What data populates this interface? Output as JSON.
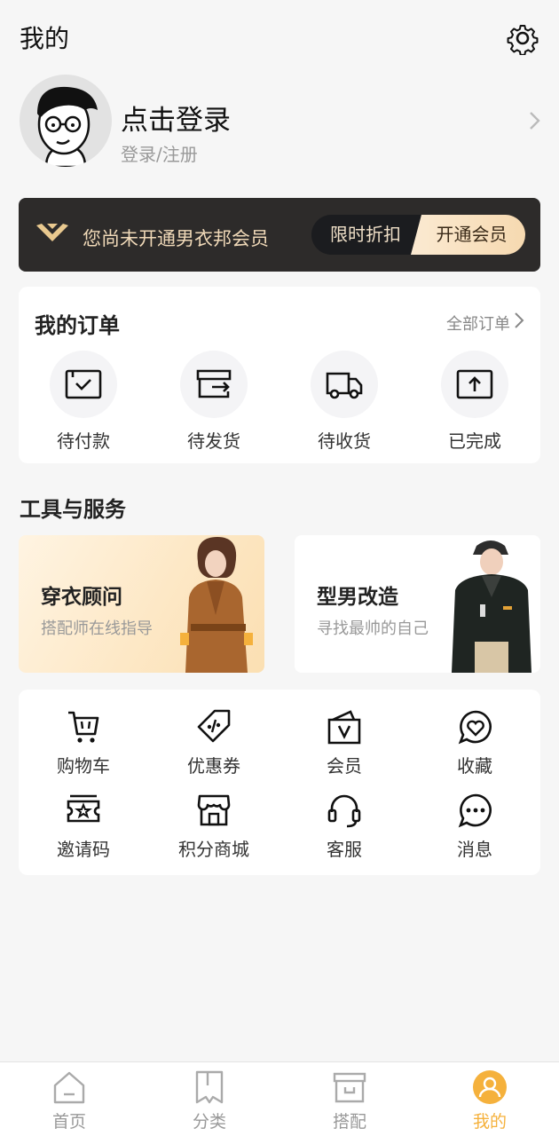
{
  "header": {
    "title": "我的",
    "settings_icon": "gear-icon"
  },
  "profile": {
    "title": "点击登录",
    "subtitle": "登录/注册",
    "avatar_icon": "cartoon-avatar"
  },
  "vip": {
    "text": "您尚未开通男衣邦会员",
    "discount_label": "限时折扣",
    "open_label": "开通会员",
    "accent": "#f0d9b8"
  },
  "orders": {
    "title": "我的订单",
    "all_label": "全部订单",
    "items": [
      {
        "label": "待付款",
        "icon": "wallet-check-icon"
      },
      {
        "label": "待发货",
        "icon": "box-send-icon"
      },
      {
        "label": "待收货",
        "icon": "truck-icon"
      },
      {
        "label": "已完成",
        "icon": "box-up-icon"
      }
    ]
  },
  "tools": {
    "title": "工具与服务",
    "promos": [
      {
        "title": "穿衣顾问",
        "subtitle": "搭配师在线指导"
      },
      {
        "title": "型男改造",
        "subtitle": "寻找最帅的自己"
      }
    ],
    "services": [
      {
        "label": "购物车",
        "icon": "cart-icon"
      },
      {
        "label": "优惠券",
        "icon": "coupon-tag-icon"
      },
      {
        "label": "会员",
        "icon": "vip-box-icon"
      },
      {
        "label": "收藏",
        "icon": "heart-chat-icon"
      },
      {
        "label": "邀请码",
        "icon": "ticket-star-icon"
      },
      {
        "label": "积分商城",
        "icon": "store-icon"
      },
      {
        "label": "客服",
        "icon": "headset-icon"
      },
      {
        "label": "消息",
        "icon": "chat-dots-icon"
      }
    ]
  },
  "tabbar": {
    "active_color": "#f5b13c",
    "tabs": [
      {
        "label": "首页",
        "icon": "home-icon"
      },
      {
        "label": "分类",
        "icon": "bookmark-icon"
      },
      {
        "label": "搭配",
        "icon": "archive-box-icon"
      },
      {
        "label": "我的",
        "icon": "user-icon"
      }
    ]
  }
}
